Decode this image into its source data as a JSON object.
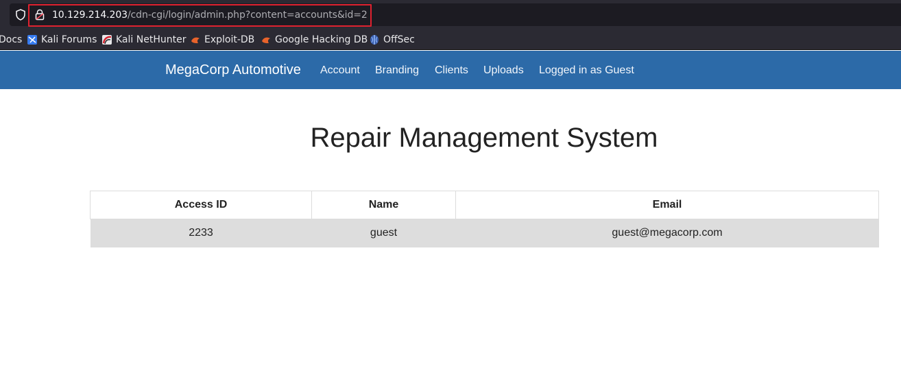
{
  "browser": {
    "url": {
      "host": "10.129.214.203",
      "path": "/cdn-cgi/login/admin.php?content=accounts&id=2"
    },
    "bookmarks": [
      {
        "label": "Docs",
        "icon": "docs-icon"
      },
      {
        "label": "Kali Forums",
        "icon": "kali-forums-icon"
      },
      {
        "label": "Kali NetHunter",
        "icon": "kali-nethunter-icon"
      },
      {
        "label": "Exploit-DB",
        "icon": "exploit-db-icon"
      },
      {
        "label": "Google Hacking DB",
        "icon": "google-hacking-db-icon"
      },
      {
        "label": "OffSec",
        "icon": "offsec-icon"
      }
    ],
    "highlight_color": "#e0212f"
  },
  "navbar": {
    "brand": "MegaCorp Automotive",
    "links": [
      {
        "label": "Account"
      },
      {
        "label": "Branding"
      },
      {
        "label": "Clients"
      },
      {
        "label": "Uploads"
      },
      {
        "label": "Logged in as Guest"
      }
    ],
    "color": "#2c6aa8"
  },
  "main": {
    "title": "Repair Management System",
    "table": {
      "headers": [
        "Access ID",
        "Name",
        "Email"
      ],
      "rows": [
        [
          "2233",
          "guest",
          "guest@megacorp.com"
        ]
      ]
    }
  }
}
